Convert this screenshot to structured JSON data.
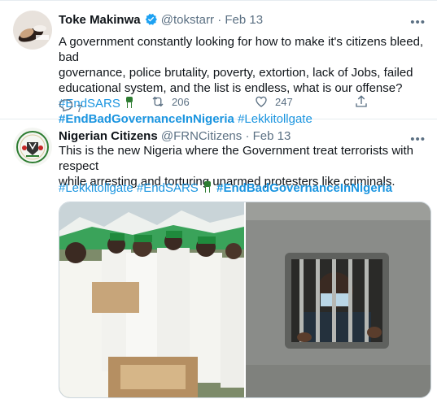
{
  "tweet1": {
    "name": "Toke Makinwa",
    "handle": "@tokstarr",
    "date": "Feb 13",
    "text_l1": "A government constantly looking for how to make it's citizens bleed, bad",
    "text_l2": "governance, police brutality, poverty, extortion, lack of Jobs, failed",
    "text_l3_prefix": "educational system, and the list is endless, what is our offense? ",
    "hashtag_endsars": "#EndSARS",
    "hashtag_bad_gov": "#EndBadGovernanceInNigeria",
    "hashtag_lekki": "#Lekkitollgate",
    "reply_count": "7",
    "retweet_count": "206",
    "like_count": "247"
  },
  "tweet2": {
    "name": "Nigerian Citizens",
    "handle": "@FRNCitizens",
    "date": "Feb 13",
    "text_l1": "This is the new Nigeria where the Government treat terrorists with respect",
    "text_l2": "while arresting and torturing unarmed protesters like criminals.",
    "hashtag_lekki": "#Lekkitollgate",
    "hashtag_endsars": "#EndSARS",
    "hashtag_bad_gov": "#EndBadGovernanceInNigeria"
  },
  "colors": {
    "link": "#1b95e0",
    "secondary": "#5b7083",
    "verified": "#1da1f2"
  }
}
